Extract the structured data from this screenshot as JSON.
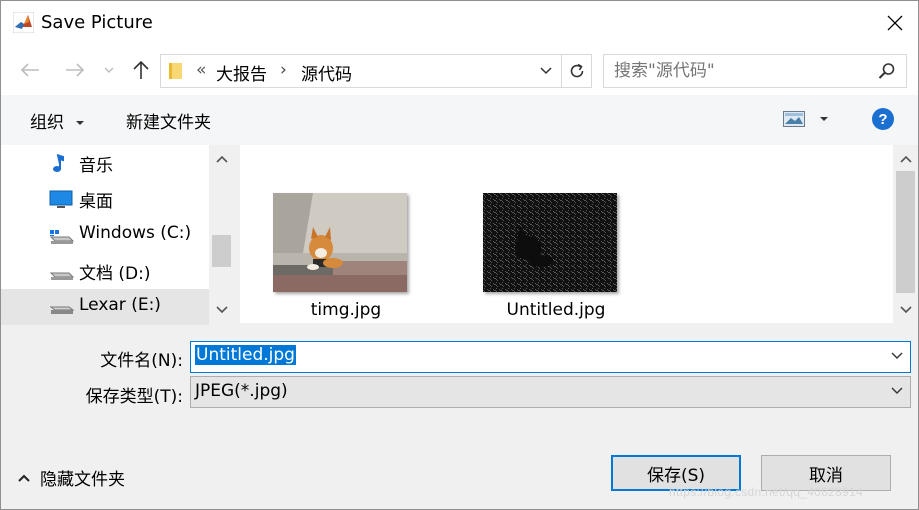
{
  "window": {
    "title": "Save Picture",
    "app_icon": "matlab-icon",
    "close_icon": "close-icon"
  },
  "nav_buttons": {
    "back_icon": "back-arrow-icon",
    "forward_icon": "forward-arrow-icon",
    "recent_icon": "chevron-down-icon",
    "up_icon": "up-arrow-icon"
  },
  "address": {
    "overflow": "«",
    "crumbs": [
      "大报告",
      "源代码"
    ],
    "separator": "›"
  },
  "search": {
    "placeholder": "搜索\"源代码\""
  },
  "toolbar": {
    "organize_label": "组织",
    "new_folder_label": "新建文件夹",
    "help_label": "?"
  },
  "nav_pane": {
    "items": [
      {
        "label": "音乐",
        "icon": "music-icon"
      },
      {
        "label": "桌面",
        "icon": "desktop-icon"
      },
      {
        "label": "Windows (C:)",
        "icon": "windows-drive-icon"
      },
      {
        "label": "文档 (D:)",
        "icon": "drive-icon"
      },
      {
        "label": "Lexar (E:)",
        "icon": "usb-drive-icon",
        "selected": true
      }
    ]
  },
  "files": [
    {
      "name": "timg.jpg",
      "thumbnail": "dog-photo"
    },
    {
      "name": "Untitled.jpg",
      "thumbnail": "dog-edge-photo"
    }
  ],
  "form": {
    "filename_label": "文件名(N):",
    "filename_value": "Untitled.jpg",
    "filetype_label": "保存类型(T):",
    "filetype_value": "JPEG(*.jpg)"
  },
  "footer": {
    "hide_folders_label": "隐藏文件夹",
    "save_label": "保存(S)",
    "cancel_label": "取消",
    "watermark": "https://blog.csdn.net/qq_40828914"
  },
  "colors": {
    "accent": "#0078d7",
    "help_blue": "#1a6fd1"
  }
}
